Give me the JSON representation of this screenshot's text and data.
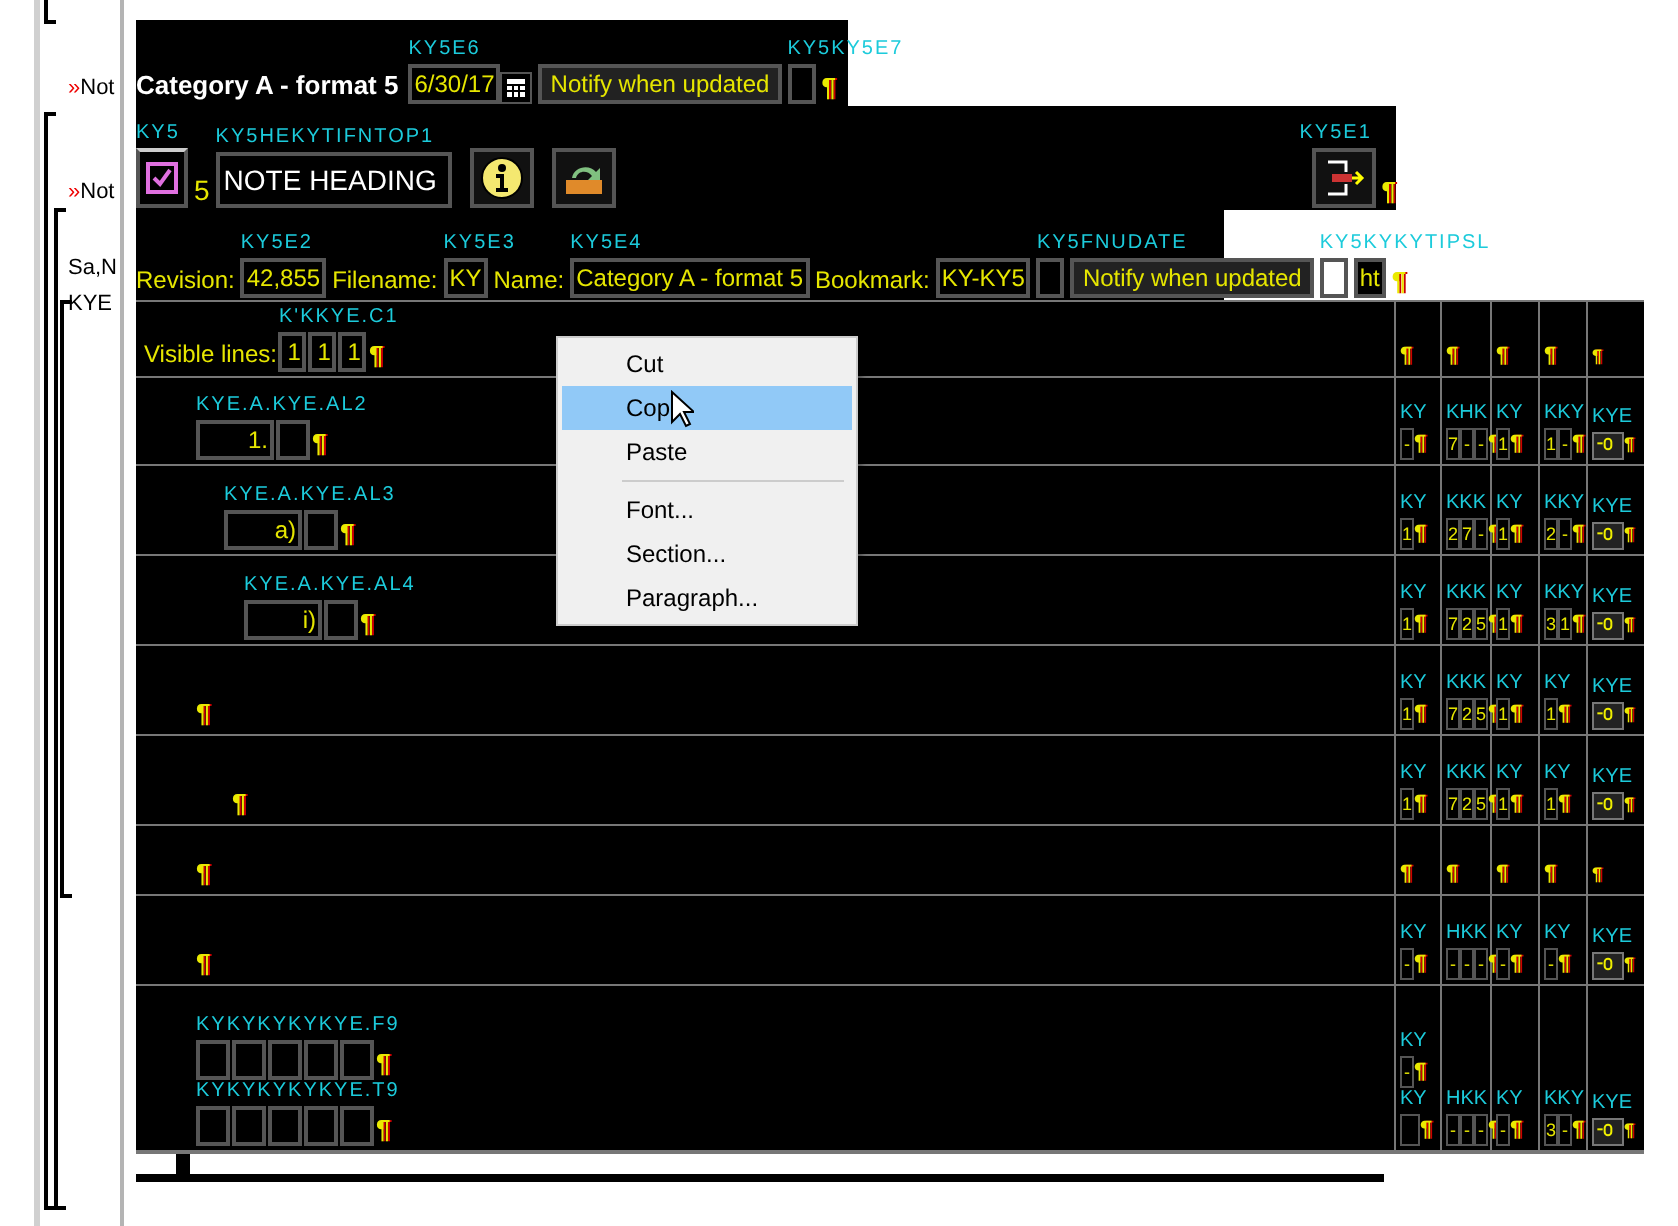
{
  "margin": {
    "items": [
      {
        "kind": "note",
        "marker": "»",
        "text": "Not"
      },
      {
        "kind": "note",
        "marker": "»",
        "text": "Not"
      },
      {
        "kind": "text",
        "text": "Sa,N"
      },
      {
        "kind": "text",
        "text": "KYE"
      }
    ]
  },
  "title_bar": {
    "left": [
      {
        "kind": "title",
        "text": "Category A - format 5"
      },
      {
        "kind": "field",
        "value": "6/30/17",
        "tag": "KY5E6"
      },
      {
        "kind": "calendar-button"
      },
      {
        "kind": "button",
        "text": "Notify when updated"
      },
      {
        "kind": "box",
        "tag": "KY5KY5E7"
      },
      {
        "kind": "mark",
        "text": "¶"
      }
    ]
  },
  "heading_bar": {
    "left": [
      {
        "kind": "checkbox",
        "checked": true,
        "tag": "KY5"
      },
      {
        "kind": "text",
        "text": "5"
      },
      {
        "kind": "field",
        "value": "NOTE HEADING",
        "tag": "KY5HEKYTIFNTOP1"
      },
      {
        "kind": "info-button"
      },
      {
        "kind": "refresh-button"
      }
    ],
    "right": [
      {
        "kind": "exit-button",
        "tag": "KY5E1"
      },
      {
        "kind": "mark",
        "text": "¶"
      }
    ]
  },
  "props_bar": {
    "left": [
      {
        "kind": "text",
        "text": "Revision:"
      },
      {
        "kind": "field",
        "value": "42,855",
        "tag": "KY5E2"
      },
      {
        "kind": "text",
        "text": "Filename:"
      },
      {
        "kind": "field",
        "value": "KY",
        "tag": "KY5E3"
      },
      {
        "kind": "text",
        "text": "Name:"
      },
      {
        "kind": "field",
        "value": "Category A - format 5",
        "tag": "KY5E4"
      },
      {
        "kind": "text",
        "text": "Bookmark:"
      },
      {
        "kind": "field",
        "value": "KY-KY5"
      },
      {
        "kind": "box",
        "tag": "KY5FNUDATE"
      },
      {
        "kind": "button",
        "text": "Notify when updated"
      },
      {
        "kind": "box",
        "tag": "KY5KYKYTIPSL"
      },
      {
        "kind": "field",
        "value": "ht"
      },
      {
        "kind": "mark",
        "text": "¶"
      }
    ]
  },
  "table": {
    "rows": [
      {
        "left": {
          "items": [
            {
              "kind": "text",
              "text": "Visible lines:"
            },
            {
              "kind": "field",
              "value": "1",
              "tag": "K'KKYE.C1"
            },
            {
              "kind": "field",
              "value": "1"
            },
            {
              "kind": "field",
              "value": "1"
            },
            {
              "kind": "mark",
              "text": "¶"
            }
          ]
        },
        "cells": [
          {
            "items": [
              {
                "kind": "mark",
                "text": "¶"
              }
            ]
          },
          {
            "items": [
              {
                "kind": "mark",
                "text": "¶"
              }
            ]
          },
          {
            "items": [
              {
                "kind": "mark",
                "text": "¶"
              }
            ]
          },
          {
            "items": [
              {
                "kind": "mark",
                "text": "¶"
              }
            ]
          },
          {
            "items": [
              {
                "kind": "mark",
                "text": "¶"
              }
            ]
          }
        ]
      },
      {
        "left": {
          "items": [
            {
              "kind": "field",
              "value": "1.",
              "tag": "KYE.A.KYE.AL2"
            },
            {
              "kind": "box"
            },
            {
              "kind": "mark",
              "text": "¶"
            }
          ]
        },
        "cells": [
          {
            "items": [
              {
                "kind": "field",
                "value": "-",
                "tag": "KY"
              },
              {
                "kind": "mark",
                "text": "¶"
              }
            ]
          },
          {
            "items": [
              {
                "kind": "field",
                "value": "7",
                "tag": "KHK"
              },
              {
                "kind": "field",
                "value": "-"
              },
              {
                "kind": "field",
                "value": "-"
              },
              {
                "kind": "mark",
                "text": "¶"
              }
            ]
          },
          {
            "items": [
              {
                "kind": "field",
                "value": "1",
                "tag": "KY"
              },
              {
                "kind": "mark",
                "text": "¶"
              }
            ]
          },
          {
            "items": [
              {
                "kind": "field",
                "value": "1",
                "tag": "KKY"
              },
              {
                "kind": "field",
                "value": "-"
              },
              {
                "kind": "mark",
                "text": "¶"
              }
            ]
          },
          {
            "items": [
              {
                "kind": "switch-button",
                "tag": "KYE"
              },
              {
                "kind": "mark",
                "text": "¶"
              }
            ]
          }
        ]
      },
      {
        "left": {
          "items": [
            {
              "kind": "field",
              "value": "a)",
              "tag": "KYE.A.KYE.AL3"
            },
            {
              "kind": "box"
            },
            {
              "kind": "mark",
              "text": "¶"
            }
          ]
        },
        "cells": [
          {
            "items": [
              {
                "kind": "field",
                "value": "1",
                "tag": "KY"
              },
              {
                "kind": "mark",
                "text": "¶"
              }
            ]
          },
          {
            "items": [
              {
                "kind": "field",
                "value": "2",
                "tag": "KKK"
              },
              {
                "kind": "field",
                "value": "7"
              },
              {
                "kind": "field",
                "value": "-"
              },
              {
                "kind": "mark",
                "text": "¶"
              }
            ]
          },
          {
            "items": [
              {
                "kind": "field",
                "value": "1",
                "tag": "KY"
              },
              {
                "kind": "mark",
                "text": "¶"
              }
            ]
          },
          {
            "items": [
              {
                "kind": "field",
                "value": "2",
                "tag": "KKY"
              },
              {
                "kind": "field",
                "value": "-"
              },
              {
                "kind": "mark",
                "text": "¶"
              }
            ]
          },
          {
            "items": [
              {
                "kind": "switch-button",
                "tag": "KYE"
              },
              {
                "kind": "mark",
                "text": "¶"
              }
            ]
          }
        ]
      },
      {
        "left": {
          "items": [
            {
              "kind": "field",
              "value": "i)",
              "tag": "KYE.A.KYE.AL4"
            },
            {
              "kind": "box"
            },
            {
              "kind": "mark",
              "text": "¶"
            }
          ]
        },
        "cells": [
          {
            "items": [
              {
                "kind": "field",
                "value": "1",
                "tag": "KY"
              },
              {
                "kind": "mark",
                "text": "¶"
              }
            ]
          },
          {
            "items": [
              {
                "kind": "field",
                "value": "7",
                "tag": "KKK"
              },
              {
                "kind": "field",
                "value": "2"
              },
              {
                "kind": "field",
                "value": "5"
              },
              {
                "kind": "mark",
                "text": "¶"
              }
            ]
          },
          {
            "items": [
              {
                "kind": "field",
                "value": "1",
                "tag": "KY"
              },
              {
                "kind": "mark",
                "text": "¶"
              }
            ]
          },
          {
            "items": [
              {
                "kind": "field",
                "value": "3",
                "tag": "KKY"
              },
              {
                "kind": "field",
                "value": "1"
              },
              {
                "kind": "mark",
                "text": "¶"
              }
            ]
          },
          {
            "items": [
              {
                "kind": "switch-button",
                "tag": "KYE"
              },
              {
                "kind": "mark",
                "text": "¶"
              }
            ]
          }
        ]
      },
      {
        "left": {
          "items": [
            {
              "kind": "mark",
              "text": "¶"
            }
          ]
        },
        "cells": [
          {
            "items": [
              {
                "kind": "field",
                "value": "1",
                "tag": "KY"
              },
              {
                "kind": "mark",
                "text": "¶"
              }
            ]
          },
          {
            "items": [
              {
                "kind": "field",
                "value": "7",
                "tag": "KKK"
              },
              {
                "kind": "field",
                "value": "2"
              },
              {
                "kind": "field",
                "value": "5"
              },
              {
                "kind": "mark",
                "text": "¶"
              }
            ]
          },
          {
            "items": [
              {
                "kind": "field",
                "value": "1",
                "tag": "KY"
              },
              {
                "kind": "mark",
                "text": "¶"
              }
            ]
          },
          {
            "items": [
              {
                "kind": "field",
                "value": "1",
                "tag": "KY"
              },
              {
                "kind": "mark",
                "text": "¶"
              }
            ]
          },
          {
            "items": [
              {
                "kind": "switch-button",
                "tag": "KYE"
              },
              {
                "kind": "mark",
                "text": "¶"
              }
            ]
          }
        ]
      },
      {
        "left": {
          "items": [
            {
              "kind": "mark",
              "text": "¶"
            }
          ]
        },
        "cells": [
          {
            "items": [
              {
                "kind": "field",
                "value": "1",
                "tag": "KY"
              },
              {
                "kind": "mark",
                "text": "¶"
              }
            ]
          },
          {
            "items": [
              {
                "kind": "field",
                "value": "7",
                "tag": "KKK"
              },
              {
                "kind": "field",
                "value": "2"
              },
              {
                "kind": "field",
                "value": "5"
              },
              {
                "kind": "mark",
                "text": "¶"
              }
            ]
          },
          {
            "items": [
              {
                "kind": "field",
                "value": "1",
                "tag": "KY"
              },
              {
                "kind": "mark",
                "text": "¶"
              }
            ]
          },
          {
            "items": [
              {
                "kind": "field",
                "value": "1",
                "tag": "KY"
              },
              {
                "kind": "mark",
                "text": "¶"
              }
            ]
          },
          {
            "items": [
              {
                "kind": "switch-button",
                "tag": "KYE"
              },
              {
                "kind": "mark",
                "text": "¶"
              }
            ]
          }
        ]
      },
      {
        "left": {
          "items": [
            {
              "kind": "mark",
              "text": "¶"
            }
          ]
        },
        "cells": [
          {
            "items": [
              {
                "kind": "mark",
                "text": "¶"
              }
            ]
          },
          {
            "items": [
              {
                "kind": "mark",
                "text": "¶"
              }
            ]
          },
          {
            "items": [
              {
                "kind": "mark",
                "text": "¶"
              }
            ]
          },
          {
            "items": [
              {
                "kind": "mark",
                "text": "¶"
              }
            ]
          },
          {
            "items": [
              {
                "kind": "mark",
                "text": "¶"
              }
            ]
          }
        ]
      },
      {
        "left": {
          "items": [
            {
              "kind": "mark",
              "text": "¶"
            }
          ]
        },
        "cells": [
          {
            "items": [
              {
                "kind": "field",
                "value": "-",
                "tag": "KY"
              },
              {
                "kind": "mark",
                "text": "¶"
              }
            ]
          },
          {
            "items": [
              {
                "kind": "field",
                "value": "-",
                "tag": "HKK"
              },
              {
                "kind": "field",
                "value": "-"
              },
              {
                "kind": "field",
                "value": "-"
              },
              {
                "kind": "mark",
                "text": "¶"
              }
            ]
          },
          {
            "items": [
              {
                "kind": "field",
                "value": "-",
                "tag": "KY"
              },
              {
                "kind": "mark",
                "text": "¶"
              }
            ]
          },
          {
            "items": [
              {
                "kind": "field",
                "value": "-",
                "tag": "KY"
              },
              {
                "kind": "mark",
                "text": "¶"
              }
            ]
          },
          {
            "items": [
              {
                "kind": "switch-button",
                "tag": "KYE"
              },
              {
                "kind": "mark",
                "text": "¶"
              }
            ]
          }
        ]
      },
      {
        "left": {
          "lines": [
            [
              {
                "kind": "box",
                "tag": "KYKYKYKYKYE.F9"
              },
              {
                "kind": "box"
              },
              {
                "kind": "box"
              },
              {
                "kind": "box"
              },
              {
                "kind": "box"
              },
              {
                "kind": "mark",
                "text": "¶"
              }
            ],
            [
              {
                "kind": "box",
                "tag": "KYKYKYKYKYE.T9"
              },
              {
                "kind": "box"
              },
              {
                "kind": "box"
              },
              {
                "kind": "box"
              },
              {
                "kind": "box"
              },
              {
                "kind": "mark",
                "text": "¶"
              }
            ]
          ]
        },
        "cells": [
          {
            "lines": [
              [
                {
                  "kind": "field",
                  "value": "-",
                  "tag": "KY"
                },
                {
                  "kind": "mark",
                  "text": "¶"
                }
              ],
              [
                {
                  "kind": "box",
                  "tag": "KY"
                },
                {
                  "kind": "mark",
                  "text": "¶"
                }
              ]
            ]
          },
          {
            "items": [
              {
                "kind": "field",
                "value": "-",
                "tag": "HKK"
              },
              {
                "kind": "field",
                "value": "-"
              },
              {
                "kind": "field",
                "value": "-"
              },
              {
                "kind": "mark",
                "text": "¶"
              }
            ]
          },
          {
            "items": [
              {
                "kind": "field",
                "value": "-",
                "tag": "KY"
              },
              {
                "kind": "mark",
                "text": "¶"
              }
            ]
          },
          {
            "items": [
              {
                "kind": "field",
                "value": "3",
                "tag": "KKY"
              },
              {
                "kind": "field",
                "value": "-"
              },
              {
                "kind": "mark",
                "text": "¶"
              }
            ]
          },
          {
            "items": [
              {
                "kind": "switch-button",
                "tag": "KYE"
              },
              {
                "kind": "mark",
                "text": "¶"
              }
            ]
          }
        ]
      }
    ]
  },
  "context_menu": {
    "items": [
      {
        "kind": "item",
        "text": "Cut",
        "selected": false
      },
      {
        "kind": "item",
        "text": "Cop",
        "selected": true
      },
      {
        "kind": "item",
        "text": "Paste",
        "selected": false
      },
      {
        "kind": "separator"
      },
      {
        "kind": "item",
        "text": "Font...",
        "selected": false
      },
      {
        "kind": "item",
        "text": "Section...",
        "selected": false
      },
      {
        "kind": "item",
        "text": "Paragraph...",
        "selected": false
      }
    ]
  }
}
